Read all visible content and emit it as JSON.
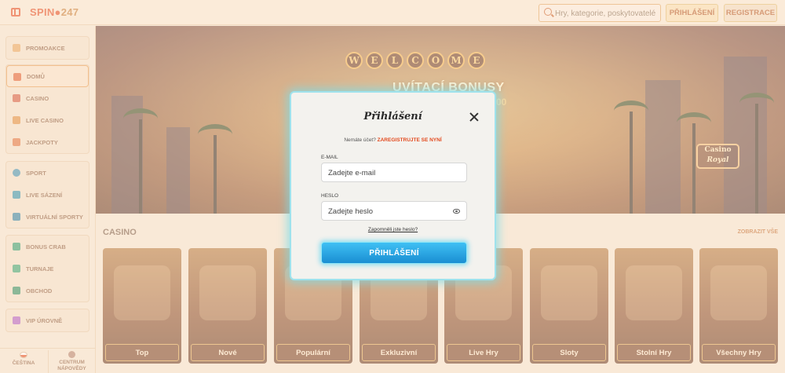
{
  "header": {
    "logo_main": "SPIN",
    "logo_suffix": "247",
    "search_placeholder": "Hry, kategorie, poskytovatelé",
    "login_label": "PŘIHLÁŠENÍ",
    "register_label": "REGISTRACE"
  },
  "sidebar": {
    "group1": [
      {
        "label": "PROMOAKCE",
        "icon": "gift-icon"
      }
    ],
    "group2": [
      {
        "label": "DOMŮ",
        "icon": "home-icon",
        "active": true
      },
      {
        "label": "CASINO",
        "icon": "casino-icon"
      },
      {
        "label": "LIVE CASINO",
        "icon": "live-casino-icon"
      },
      {
        "label": "JACKPOTY",
        "icon": "jackpot-icon"
      }
    ],
    "group3": [
      {
        "label": "SPORT",
        "icon": "ball-icon"
      },
      {
        "label": "LIVE SÁZENÍ",
        "icon": "live-bet-icon"
      },
      {
        "label": "VIRTUÁLNÍ SPORTY",
        "icon": "virtual-sport-icon"
      }
    ],
    "group4": [
      {
        "label": "BONUS CRAB",
        "icon": "crab-icon"
      },
      {
        "label": "TURNAJE",
        "icon": "trophy-icon"
      },
      {
        "label": "OBCHOD",
        "icon": "shop-icon"
      }
    ],
    "group5": [
      {
        "label": "VIP ÚROVNĚ",
        "icon": "diamond-icon"
      }
    ],
    "footer": {
      "language": "ČEŠTINA",
      "help_line1": "CENTRUM",
      "help_line2": "NÁPOVĚDY"
    }
  },
  "hero": {
    "sign_letters": [
      "W",
      "E",
      "L",
      "C",
      "O",
      "M",
      "E"
    ],
    "title": "UVÍTACÍ BONUSY",
    "amount": "00"
  },
  "casino_section": {
    "title": "CASINO",
    "see_all": "ZOBRAZIT VŠE",
    "cards": [
      "Top",
      "Nové",
      "Populární",
      "Exkluzivní",
      "Live Hry",
      "Sloty",
      "Stolní Hry",
      "Všechny Hry"
    ]
  },
  "modal": {
    "title": "Přihlášení",
    "no_account_text": "Nemáte účet?",
    "register_link": "Zaregistrujte se nyní",
    "email_label": "E-MAIL",
    "email_placeholder": "Zadejte e-mail",
    "password_label": "HESLO",
    "password_placeholder": "Zadejte heslo",
    "forgot_link": "Zapomněli jste heslo?",
    "submit_label": "PŘIHLÁŠENÍ"
  },
  "colors": {
    "brand": "#e34a1e",
    "modal_glow": "#9fe2ec",
    "submit_button": "#1a8ed2"
  }
}
